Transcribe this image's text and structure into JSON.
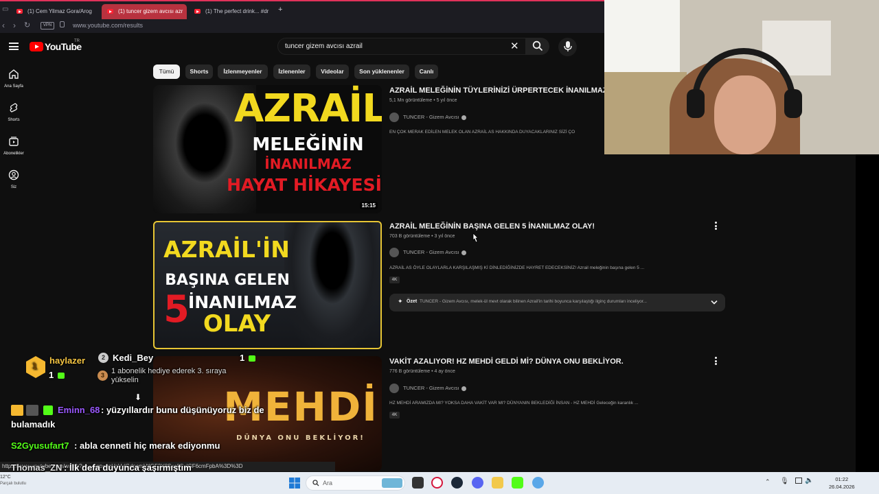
{
  "browser": {
    "tabs": [
      {
        "label": "(1) Cem Yilmaz Gora/Arog"
      },
      {
        "label": "(1) tuncer gizem avcısı azr"
      },
      {
        "label": "(1) The perfect drink... #dr"
      }
    ],
    "vpn": "VPN",
    "url": "www.youtube.com/results"
  },
  "header": {
    "logo": "YouTube",
    "country": "TR",
    "search_query": "tuncer gizem avcısı azrail"
  },
  "sidebar": {
    "items": [
      {
        "label": "Ana Sayfa",
        "icon": "home-icon"
      },
      {
        "label": "Shorts",
        "icon": "shorts-icon"
      },
      {
        "label": "Abonelikler",
        "icon": "subscriptions-icon"
      },
      {
        "label": "Siz",
        "icon": "account-icon"
      }
    ]
  },
  "chips": [
    "Tümü",
    "Shorts",
    "İzlenmeyenler",
    "İzlenenler",
    "Videolar",
    "Son yüklenenler",
    "Canlı"
  ],
  "results": [
    {
      "title": "AZRAİL MELEĞİNİN TÜYLERİNİZİ ÜRPERTECEK İNANILMAZ",
      "meta": "5,1 Mn görüntüleme • 5 yıl önce",
      "channel": "TUNCER - Gizem Avcısı",
      "description": "EN ÇOK MERAK EDİLEN MELEK OLAN AZRAİL AS HAKKINDA DUYACAKLARINIZ SİZİ ÇO",
      "duration": "15:15",
      "thumb": {
        "line1": "AZRAİL",
        "line2": "MELEĞİNİN",
        "line3": "İNANILMAZ",
        "line4": "HAYAT HİKAYESİ"
      }
    },
    {
      "title": "AZRAİL MELEĞİNİN BAŞINA GELEN 5 İNANILMAZ OLAY!",
      "meta": "703 B görüntüleme • 3 yıl önce",
      "channel": "TUNCER - Gizem Avcısı",
      "description": "AZRAİL AS ÖYLE OLAYLARLA KARŞILAŞMIŞ Kİ DİNLEDİĞİNİZDE HAYRET EDECEKSİNİZ! Azrail meleğinin başına gelen 5 ...",
      "badge": "4K",
      "summary_label": "Özet",
      "summary": "TUNCER - Gizem Avcısı, melek-ül mevt olarak bilinen Azrail'in tarihi boyunca karşılaştığı ilginç durumları inceliyor...",
      "thumb": {
        "line1": "AZRAİL'İN",
        "line2": "BAŞINA GELEN",
        "line3": "5",
        "line4": "İNANILMAZ",
        "line5": "OLAY"
      }
    },
    {
      "title": "VAKİT AZALIYOR! HZ MEHDİ GELDİ Mİ? DÜNYA ONU BEKLİYOR.",
      "meta": "776 B görüntüleme • 4 ay önce",
      "channel": "TUNCER - Gizem Avcısı",
      "description": "HZ MEHDİ ARAMIZDA MI? YOKSA DAHA VAKİT VAR MI? DÜNYANIN BEKLEDİĞİ İNSAN - HZ MEHDİ Geleceğin karanlık ...",
      "badge": "4K",
      "thumb": {
        "line1": "MEHDİ",
        "line2": "DÜNYA ONU BEKLİYOR!"
      }
    }
  ],
  "overlay": {
    "rank": "1",
    "user1": "haylazer",
    "user1_count": "1",
    "rank2": "2",
    "user2": "Kedi_Bey",
    "user2_count": "1",
    "rank3": "3",
    "promo": "1 abonelik hediye ederek 3. sıraya",
    "promo2": "yükselin",
    "chat": [
      {
        "user": "Eminn_68",
        "text": ": yüzyıllardır bunu düşünüyoruz biz de"
      },
      {
        "user": "",
        "text": "bulamadık"
      },
      {
        "user": "S2Gyusufart7",
        "text": ": abla cenneti hiç merak ediyonmu"
      },
      {
        "user": "Thomas_ZN",
        "text": ": İlk defa duyunca şaşırmıştım"
      }
    ]
  },
  "status_url": "https://www.youtube.com/watch?v=...&pp=ygUcVylGdpemVtIGF2Y8Sxc8SxIGF6cmFpbA%3D%3D",
  "taskbar": {
    "search_placeholder": "Ara",
    "weather": "12°C",
    "weather_desc": "Parçalı bulutlu",
    "time": "01:22",
    "date": "26.04.2026"
  },
  "colors": {
    "accent": "#ff0000",
    "bg": "#0f0f0f",
    "chip": "#272727",
    "thumb_yellow": "#f2d91f",
    "thumb_red": "#e21b24"
  }
}
